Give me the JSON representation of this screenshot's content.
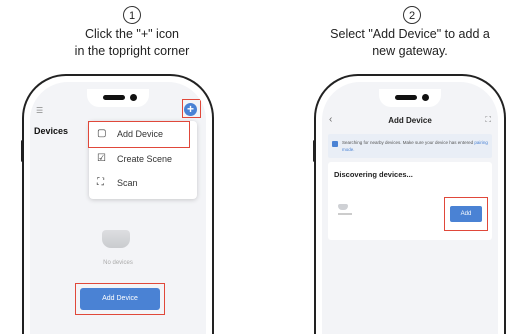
{
  "steps": [
    {
      "number": "1",
      "line1": "Click the \"+\" icon",
      "line2": "in the topright corner"
    },
    {
      "number": "2",
      "line1": "Select \"Add Device\" to add a",
      "line2": "new gateway."
    }
  ],
  "phone1": {
    "menu_icon": "☰",
    "header": "Devices",
    "plus": "+",
    "menu": [
      {
        "icon": "▢",
        "label": "Add Device"
      },
      {
        "icon": "☑",
        "label": "Create Scene"
      },
      {
        "icon": "⛶",
        "label": "Scan"
      }
    ],
    "empty_text": "No devices",
    "button": "Add Device"
  },
  "phone2": {
    "back": "‹",
    "title": "Add Device",
    "scan": "⛶",
    "banner_text": "Searching for nearby devices. Make sure your device has entered",
    "banner_link": "pairing mode.",
    "discovering": "Discovering devices...",
    "add_button": "Add"
  },
  "colors": {
    "accent": "#4a82d4",
    "highlight": "#e0483a"
  }
}
